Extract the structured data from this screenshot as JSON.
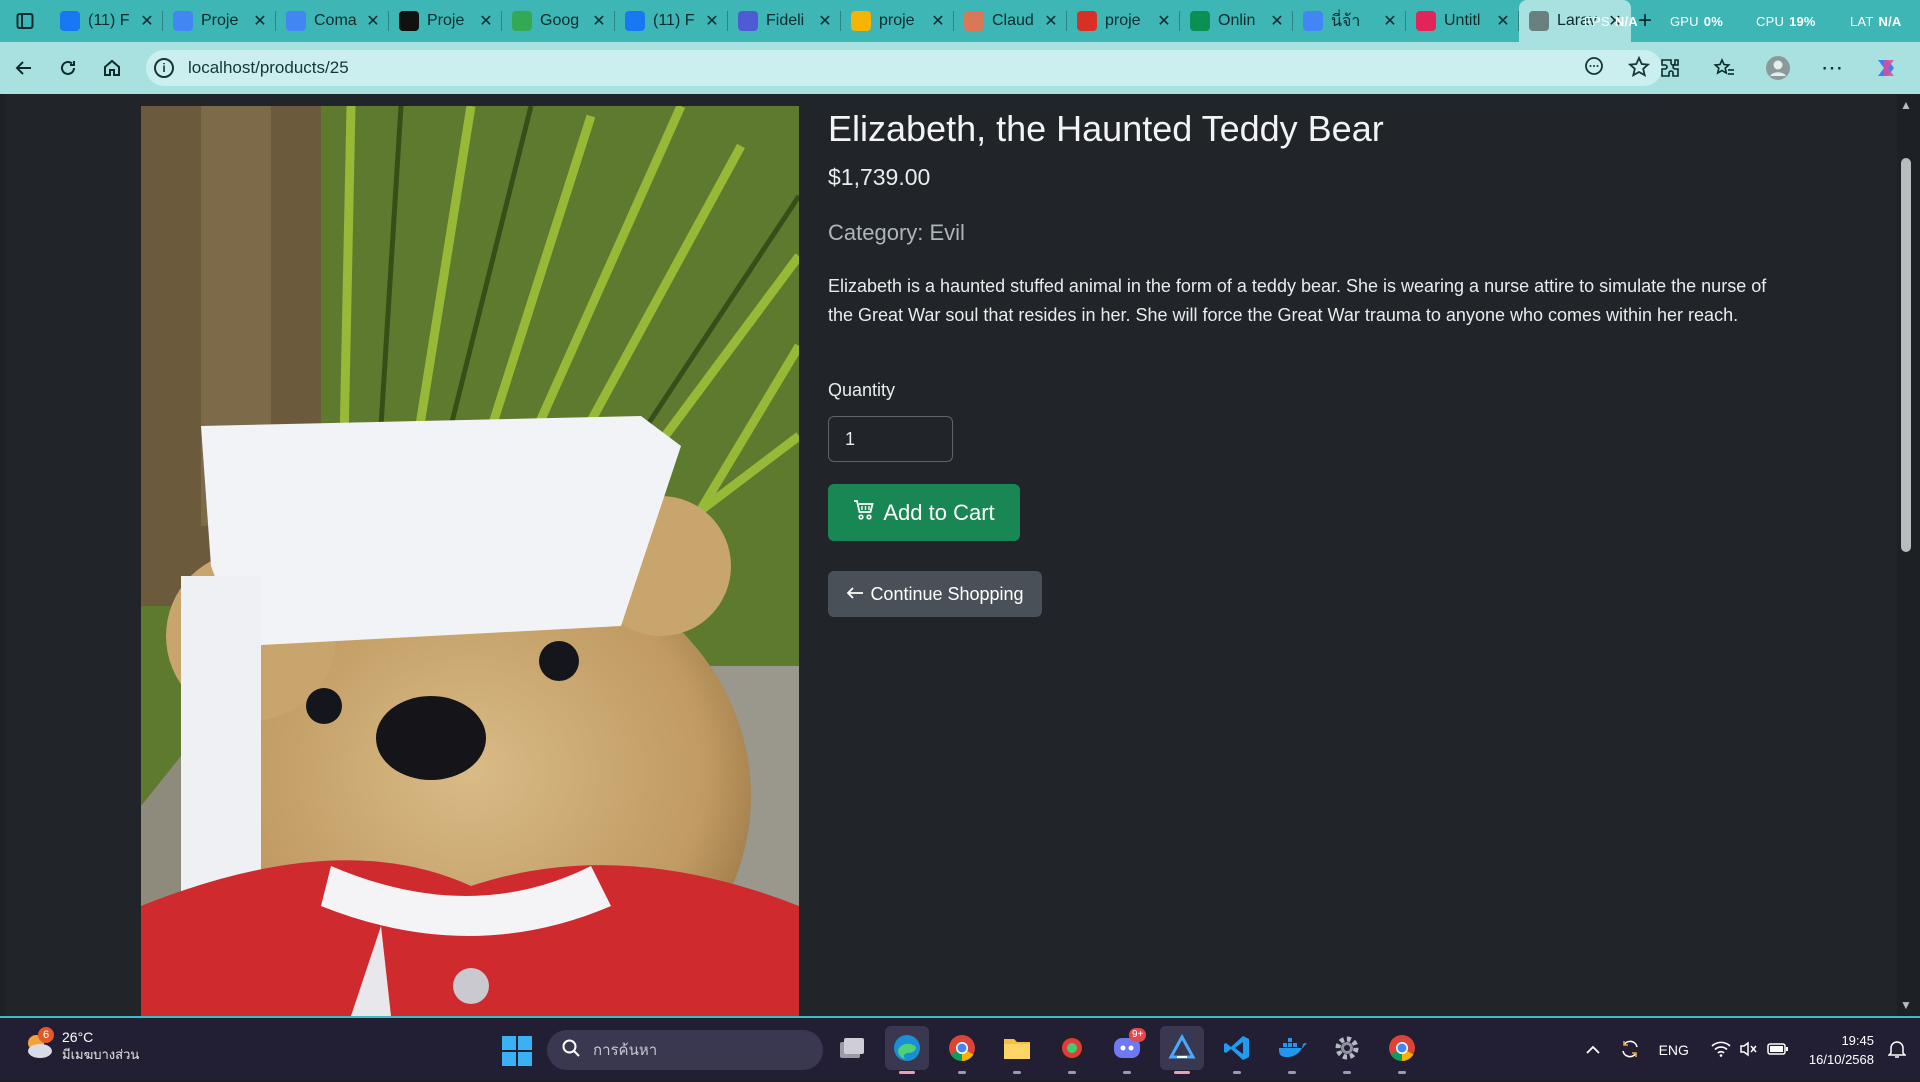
{
  "browser": {
    "tabs": [
      {
        "title": "(11) F",
        "icon": "facebook-icon",
        "color": "#1877f2"
      },
      {
        "title": "Proje",
        "icon": "google-docs-icon",
        "color": "#4285f4"
      },
      {
        "title": "Coma",
        "icon": "google-docs-icon",
        "color": "#4285f4"
      },
      {
        "title": "Proje",
        "icon": "github-icon",
        "color": "#111111"
      },
      {
        "title": "Goog",
        "icon": "google-icon",
        "color": "#34a853"
      },
      {
        "title": "(11) F",
        "icon": "facebook-icon",
        "color": "#1877f2"
      },
      {
        "title": "Fideli",
        "icon": "app-icon",
        "color": "#4f5bd5"
      },
      {
        "title": "proje",
        "icon": "google-drive-icon",
        "color": "#f4b400"
      },
      {
        "title": "Claud",
        "icon": "claude-icon",
        "color": "#d97757"
      },
      {
        "title": "proje",
        "icon": "pdf-icon",
        "color": "#d93025"
      },
      {
        "title": "Onlin",
        "icon": "leaf-icon",
        "color": "#0a8f55"
      },
      {
        "title": "นี่จ้า",
        "icon": "google-docs-icon",
        "color": "#4285f4"
      },
      {
        "title": "Untitl",
        "icon": "miro-icon",
        "color": "#e2245b"
      },
      {
        "title": "Larav",
        "icon": "laravel-icon",
        "color": "#6a7f7f"
      }
    ],
    "perf": {
      "fps_label": "FPS",
      "fps_value": "N/A",
      "gpu_label": "GPU",
      "gpu_value": "0%",
      "cpu_label": "CPU",
      "cpu_value": "19%",
      "lat_label": "LAT",
      "lat_value": "N/A"
    },
    "url": "localhost/products/25"
  },
  "product": {
    "name": "Elizabeth, the Haunted Teddy Bear",
    "price": "$1,739.00",
    "category": "Category: Evil",
    "description": "Elizabeth is a haunted stuffed animal in the form of a teddy bear. She is wearing a nurse attire to simulate the nurse of the Great War soul that resides in her. She will force the Great War trauma to anyone who comes within her reach.",
    "quantity_label": "Quantity",
    "quantity_value": "1",
    "add_to_cart": "Add to Cart",
    "continue_shopping": "Continue Shopping",
    "colors": {
      "add_button": "#198754",
      "continue_button": "#495057"
    }
  },
  "taskbar": {
    "weather_badge": "6",
    "temperature": "26°C",
    "condition": "มีเมฆบางส่วน",
    "search_placeholder": "การค้นหา",
    "discord_badge": "9+",
    "language": "ENG",
    "time": "19:45",
    "date": "16/10/2568"
  }
}
